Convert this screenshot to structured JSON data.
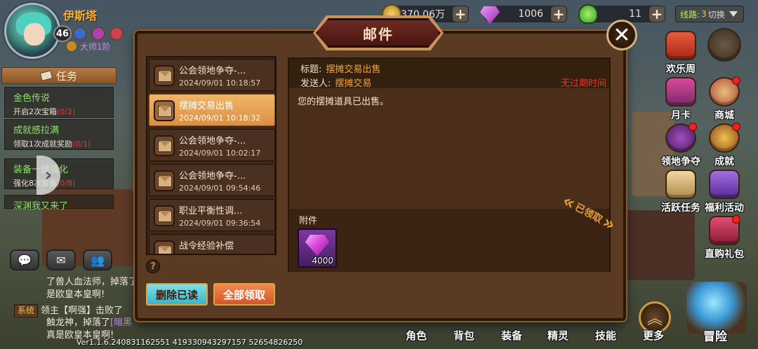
{
  "player": {
    "name": "伊斯塔",
    "level": "46",
    "title": "大师1阶"
  },
  "resources": {
    "gold": "370.06万",
    "diamond": "1006",
    "stamina": "11"
  },
  "server": {
    "prefix": "线路:",
    "number": "3",
    "switch_label": "切换"
  },
  "quests": {
    "tab_label": "任务",
    "items": [
      {
        "title": "金色传说",
        "desc": "开启2次宝箱",
        "progress": "(0/2)"
      },
      {
        "title": "成就感拉满",
        "desc": "领取1次成就奖励",
        "progress": "(0/1)"
      },
      {
        "title": "装备一键强化",
        "desc": "强化8次装备",
        "progress": "(0/8)"
      },
      {
        "title": "深渊我又来了",
        "desc": "",
        "progress": ""
      }
    ]
  },
  "chat": [
    {
      "text": "了兽人血法师，掉落了"
    },
    {
      "text": "是欧皇本皇啊!"
    },
    {
      "tag": "系统",
      "prefix": "领主【啊强】击败了",
      "item": ""
    },
    {
      "text": "触龙神，掉落了",
      "item": "[暗黑"
    },
    {
      "text": "真是欧皇本皇啊!"
    }
  ],
  "side_menu": [
    {
      "label": "欢乐周"
    },
    {
      "label": "月卡"
    },
    {
      "label": "商城"
    },
    {
      "label": "领地争夺"
    },
    {
      "label": "成就"
    },
    {
      "label": "活跃任务"
    },
    {
      "label": "福利活动"
    },
    {
      "label": "直购礼包"
    }
  ],
  "bottom_nav": [
    "角色",
    "背包",
    "装备",
    "精灵",
    "技能",
    "更多",
    "冒险"
  ],
  "version": "Ver1.1.6.240831162551   419330943297157   52654826250",
  "mail": {
    "title": "邮件",
    "list": [
      {
        "title": "公会领地争夺-...",
        "date": "2024/09/01 10:18:57"
      },
      {
        "title": "摆摊交易出售",
        "date": "2024/09/01 10:18:32"
      },
      {
        "title": "公会领地争夺-...",
        "date": "2024/09/01 10:02:17"
      },
      {
        "title": "公会领地争夺-...",
        "date": "2024/09/01 09:54:46"
      },
      {
        "title": "职业平衡性调...",
        "date": "2024/09/01 09:36:54"
      },
      {
        "title": "战令经验补偿",
        "date": ""
      }
    ],
    "selected_index": 1,
    "detail": {
      "subject_label": "标题:",
      "subject": "摆摊交易出售",
      "sender_label": "发送人:",
      "sender": "摆摊交易",
      "expire": "无过期时间",
      "body": "您的摆摊道具已出售。",
      "attachment_label": "附件",
      "attachment_qty": "4000",
      "claimed_stamp": "已领取"
    },
    "buttons": {
      "delete_read": "删除已读",
      "claim_all": "全部领取"
    }
  },
  "colors": {
    "modal_bg": "#5a3a22",
    "active_mail": "#e9a356",
    "expire_red": "#e2392e",
    "value_orange": "#f0a540"
  }
}
